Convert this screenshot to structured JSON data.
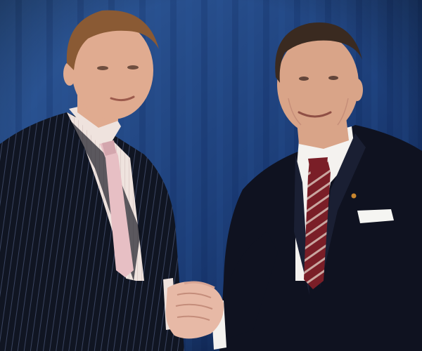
{
  "photo": {
    "kind": "photograph",
    "backdrop": {
      "icon": "curtain-backdrop-icon",
      "color_light": "#2f5a9a",
      "color_mid": "#1d3f7a",
      "color_dark": "#0d2352"
    },
    "person_left": {
      "icon": "person-in-suit-icon",
      "suit_color": "#101522",
      "pinstripe_color": "#3a4460",
      "shirt_color": "#efe3de",
      "tie_color": "#e7bfc4",
      "hair_color": "#8a5a34",
      "skin_color": "#e0ab90"
    },
    "person_right": {
      "icon": "person-in-suit-icon",
      "suit_color": "#0f1220",
      "shirt_color": "#f4f2ef",
      "tie_color": "#7a1e27",
      "tie_stripe_color": "#c9a6a0",
      "pocket_square_color": "#f5f5f2",
      "lapel_pin_color": "#c9862e",
      "hair_color": "#3a2a20",
      "skin_color": "#d9a488"
    },
    "handshake": {
      "icon": "handshake-icon",
      "skin_color": "#e7b9a6"
    }
  }
}
